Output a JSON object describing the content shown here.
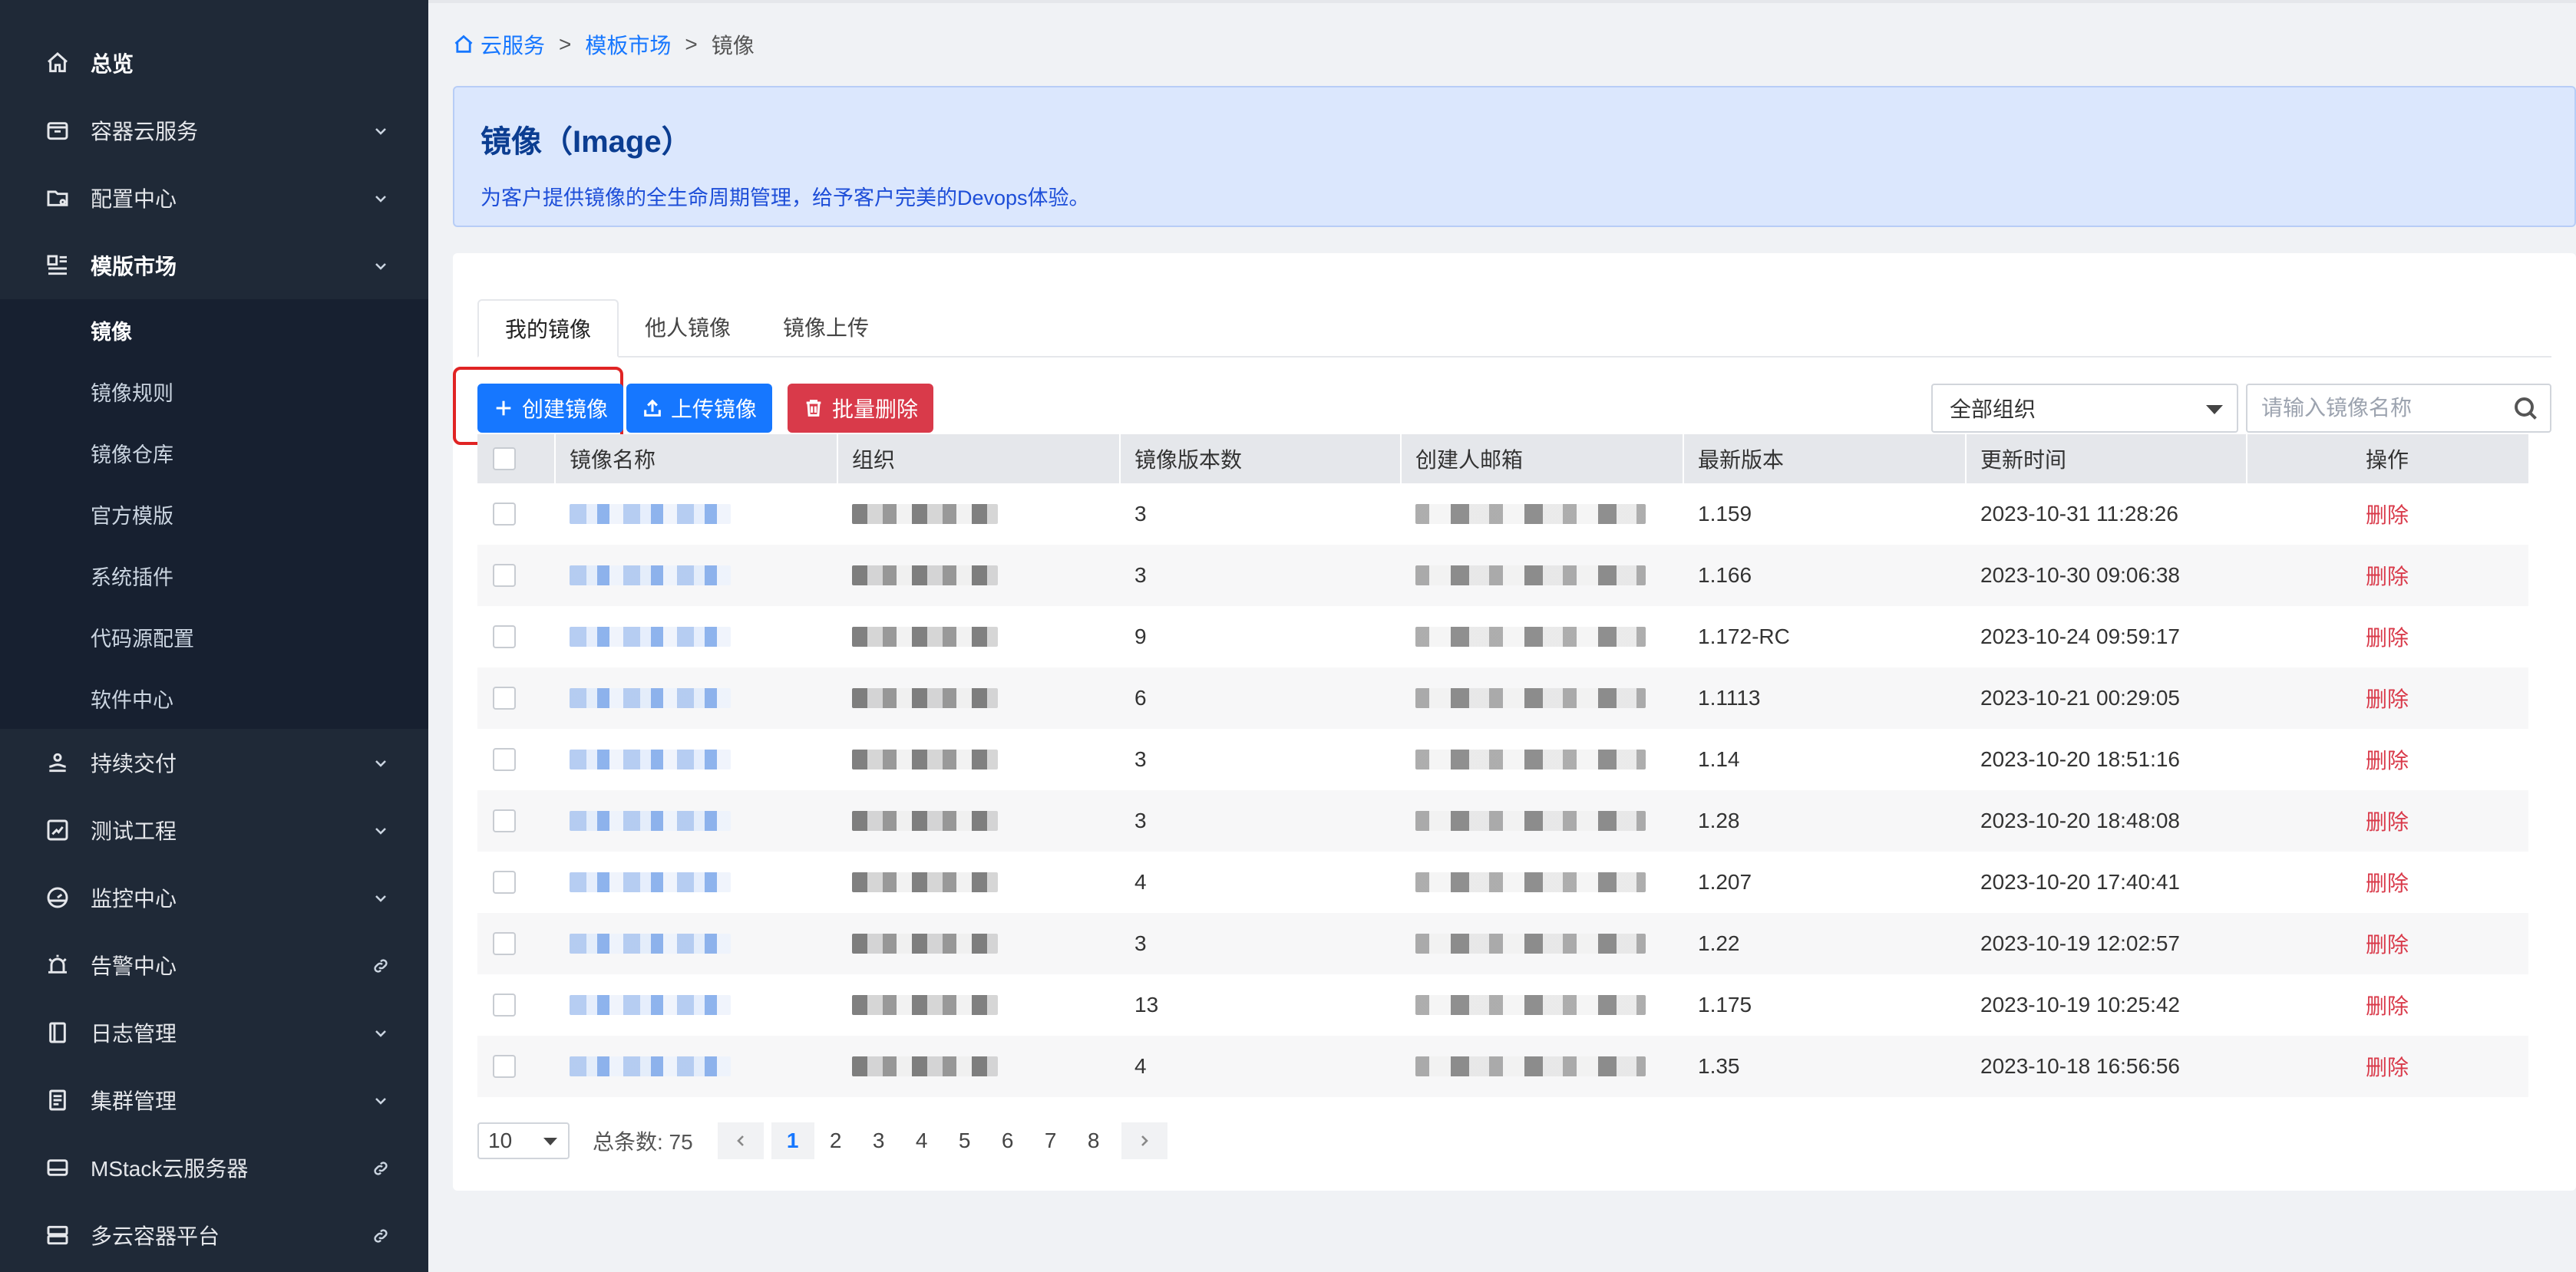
{
  "sidebar": {
    "items": [
      {
        "label": "总览",
        "icon": "home-icon",
        "suffix": ""
      },
      {
        "label": "容器云服务",
        "icon": "container-icon",
        "suffix": "chevron-down-icon"
      },
      {
        "label": "配置中心",
        "icon": "config-folder-icon",
        "suffix": "chevron-down-icon"
      },
      {
        "label": "模版市场",
        "icon": "template-icon",
        "suffix": "chevron-down-icon"
      },
      {
        "label": "持续交付",
        "icon": "delivery-icon",
        "suffix": "chevron-down-icon"
      },
      {
        "label": "测试工程",
        "icon": "test-icon",
        "suffix": "chevron-down-icon"
      },
      {
        "label": "监控中心",
        "icon": "monitor-icon",
        "suffix": "chevron-down-icon"
      },
      {
        "label": "告警中心",
        "icon": "alarm-icon",
        "suffix": "link-icon"
      },
      {
        "label": "日志管理",
        "icon": "log-icon",
        "suffix": "chevron-down-icon"
      },
      {
        "label": "集群管理",
        "icon": "cluster-icon",
        "suffix": "chevron-down-icon"
      },
      {
        "label": "MStack云服务器",
        "icon": "server-icon",
        "suffix": "link-icon"
      },
      {
        "label": "多云容器平台",
        "icon": "multicloud-icon",
        "suffix": "link-icon"
      }
    ],
    "sub_items": [
      "镜像",
      "镜像规则",
      "镜像仓库",
      "官方模版",
      "系统插件",
      "代码源配置",
      "软件中心"
    ]
  },
  "breadcrumb": {
    "home": "云服务",
    "sep": ">",
    "middle": "模板市场",
    "current": "镜像"
  },
  "banner": {
    "title": "镜像（Image）",
    "description": "为客户提供镜像的全生命周期管理，给予客户完美的Devops体验。"
  },
  "tabs": [
    "我的镜像",
    "他人镜像",
    "镜像上传"
  ],
  "toolbar": {
    "create_label": "创建镜像",
    "upload_label": "上传镜像",
    "batch_delete_label": "批量删除",
    "org_select_value": "全部组织",
    "search_placeholder": "请输入镜像名称"
  },
  "table": {
    "columns": [
      "镜像名称",
      "组织",
      "镜像版本数",
      "创建人邮箱",
      "最新版本",
      "更新时间",
      "操作"
    ],
    "rows": [
      {
        "versions": "3",
        "latest": "1.159",
        "updated": "2023-10-31 11:28:26",
        "action": "删除"
      },
      {
        "versions": "3",
        "latest": "1.166",
        "updated": "2023-10-30 09:06:38",
        "action": "删除"
      },
      {
        "versions": "9",
        "latest": "1.172-RC",
        "updated": "2023-10-24 09:59:17",
        "action": "删除"
      },
      {
        "versions": "6",
        "latest": "1.1113",
        "updated": "2023-10-21 00:29:05",
        "action": "删除"
      },
      {
        "versions": "3",
        "latest": "1.14",
        "updated": "2023-10-20 18:51:16",
        "action": "删除"
      },
      {
        "versions": "3",
        "latest": "1.28",
        "updated": "2023-10-20 18:48:08",
        "action": "删除"
      },
      {
        "versions": "4",
        "latest": "1.207",
        "updated": "2023-10-20 17:40:41",
        "action": "删除"
      },
      {
        "versions": "3",
        "latest": "1.22",
        "updated": "2023-10-19 12:02:57",
        "action": "删除"
      },
      {
        "versions": "13",
        "latest": "1.175",
        "updated": "2023-10-19 10:25:42",
        "action": "删除"
      },
      {
        "versions": "4",
        "latest": "1.35",
        "updated": "2023-10-18 16:56:56",
        "action": "删除"
      }
    ]
  },
  "pagination": {
    "page_size": "10",
    "total_label": "总条数: 75",
    "pages": [
      "1",
      "2",
      "3",
      "4",
      "5",
      "6",
      "7",
      "8"
    ],
    "current": "1"
  },
  "colors": {
    "sidebar_bg": "#1f2937",
    "primary": "#1677ff",
    "danger": "#d93a4a",
    "banner_bg": "#dbe7fd",
    "highlight": "#e02424"
  }
}
